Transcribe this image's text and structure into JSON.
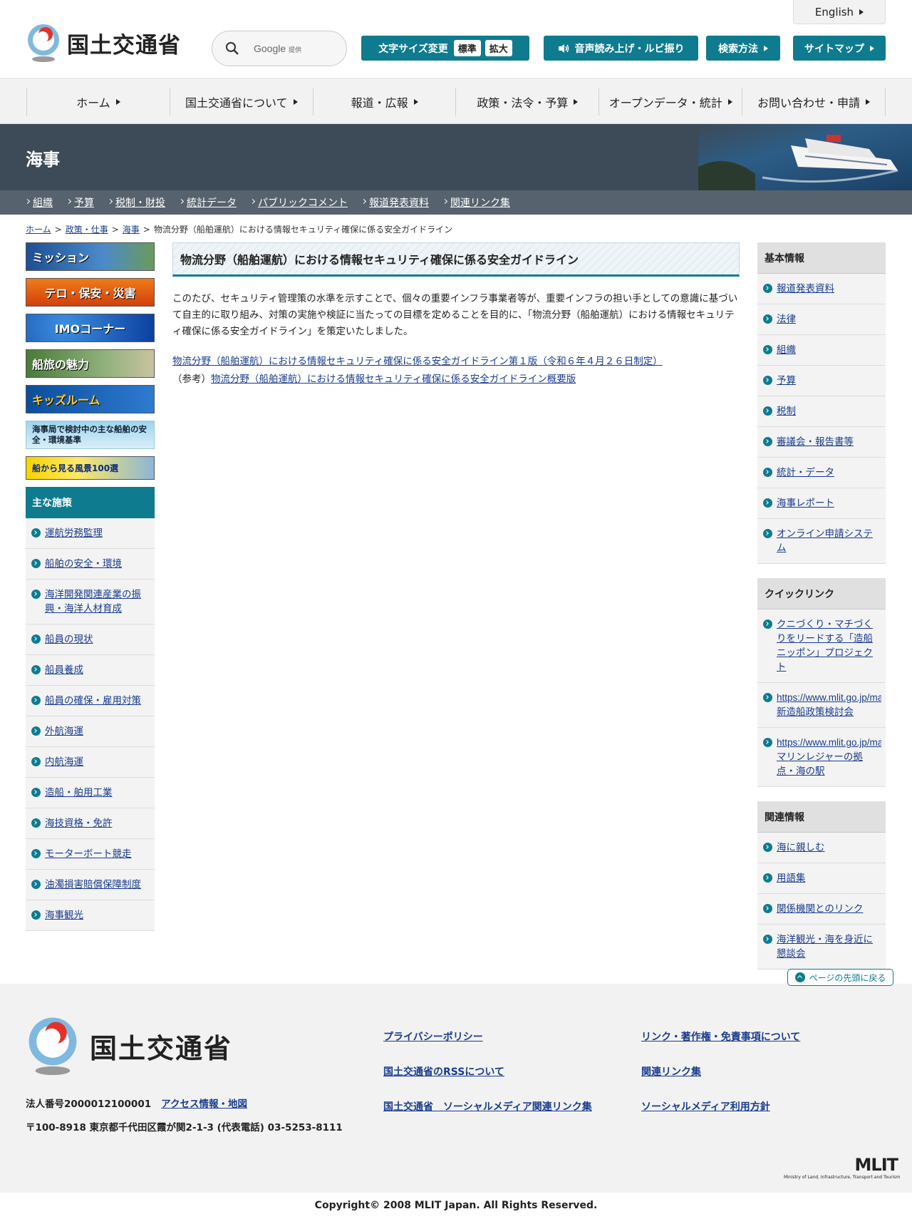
{
  "header": {
    "logo_text": "国土交通省",
    "search_placeholder": "Google",
    "search_provider": "提供",
    "english_label": "English",
    "font_size_label": "文字サイズ変更",
    "font_size_standard": "標準",
    "font_size_large": "拡大",
    "audio_label": "音声読み上げ・ルビ振り",
    "search_method_label": "検索方法",
    "sitemap_label": "サイトマップ"
  },
  "gnav": {
    "items": [
      {
        "label": "ホーム"
      },
      {
        "label": "国土交通省について"
      },
      {
        "label": "報道・広報"
      },
      {
        "label": "政策・法令・予算"
      },
      {
        "label": "オープンデータ・統計"
      },
      {
        "label": "お問い合わせ・申請"
      }
    ]
  },
  "section": {
    "title": "海事",
    "subnav": [
      {
        "label": "組織"
      },
      {
        "label": "予算"
      },
      {
        "label": "税制・財投"
      },
      {
        "label": "統計データ"
      },
      {
        "label": "パブリックコメント"
      },
      {
        "label": "報道発表資料"
      },
      {
        "label": "関連リンク集"
      }
    ]
  },
  "breadcrumb": {
    "home": "ホーム",
    "policy": "政策・仕事",
    "maritime": "海事",
    "current": "物流分野（船舶運航）における情報セキュリティ確保に係る安全ガイドライン",
    "separator": ">"
  },
  "left": {
    "banners": [
      {
        "label": "ミッション"
      },
      {
        "label": "テロ・保安・災害"
      },
      {
        "label": "IMOコーナー"
      },
      {
        "label": "船旅の魅力"
      },
      {
        "label": "キッズルーム"
      },
      {
        "label": "海事局で検討中の主な船舶の安全・環境基準"
      },
      {
        "label": "船から見る風景100選"
      }
    ],
    "policies_head": "主な施策",
    "policies": [
      {
        "label": "運航労務監理"
      },
      {
        "label": "船舶の安全・環境"
      },
      {
        "label": "海洋開発関連産業の振興・海洋人材育成"
      },
      {
        "label": "船員の現状"
      },
      {
        "label": "船員養成"
      },
      {
        "label": "船員の確保・雇用対策"
      },
      {
        "label": "外航海運"
      },
      {
        "label": "内航海運"
      },
      {
        "label": "造船・舶用工業"
      },
      {
        "label": "海技資格・免許"
      },
      {
        "label": "モーターボート競走"
      },
      {
        "label": "油濁損害賠償保障制度"
      },
      {
        "label": "海事観光"
      }
    ]
  },
  "main": {
    "title": "物流分野（船舶運航）における情報セキュリティ確保に係る安全ガイドライン",
    "body": "このたび、セキュリティ管理策の水準を示すことで、個々の重要インフラ事業者等が、重要インフラの担い手としての意識に基づいて自主的に取り組み、対策の実施や検証に当たっての目標を定めることを目的に、「物流分野（船舶運航）における情報セキュリティ確保に係る安全ガイドライン」を策定いたしました。",
    "link1": "物流分野（船舶運航）における情報セキュリティ確保に係る安全ガイドライン第１版（令和６年４月２６日制定）",
    "ref_prefix": "（参考）",
    "link2": "物流分野（船舶運航）における情報セキュリティ確保に係る安全ガイドライン概要版"
  },
  "right": {
    "basic_head": "基本情報",
    "basic": [
      {
        "label": "報道発表資料"
      },
      {
        "label": "法律"
      },
      {
        "label": "組織"
      },
      {
        "label": "予算"
      },
      {
        "label": "税制"
      },
      {
        "label": "審議会・報告書等"
      },
      {
        "label": "統計・データ"
      },
      {
        "label": "海事レポート"
      },
      {
        "label": "オンライン申請システム"
      }
    ],
    "quick_head": "クイックリンク",
    "quick": [
      {
        "label": "クニづくり・マチづくりをリードする「造船ニッポン」プロジェクト"
      },
      {
        "url": "https://www.mlit.go.jp/maritime/",
        "label": "新造船政策検討会"
      },
      {
        "url": "https://www.mlit.go.jp/maritime/",
        "label": "マリンレジャーの拠点・海の駅"
      }
    ],
    "related_head": "関連情報",
    "related": [
      {
        "label": "海に親しむ"
      },
      {
        "label": "用語集"
      },
      {
        "label": "関係機関とのリンク"
      },
      {
        "label": "海洋観光・海を身近に懇談会"
      }
    ]
  },
  "footer": {
    "pagetop": "ページの先頭に戻る",
    "logo_text": "国土交通省",
    "corp_number": "法人番号2000012100001",
    "access": "アクセス情報・地図",
    "address": "〒100-8918 東京都千代田区霞が関2-1-3 (代表電話) 03-5253-8111",
    "links": [
      {
        "label": "プライバシーポリシー"
      },
      {
        "label": "リンク・著作権・免責事項について"
      },
      {
        "label": "国土交通省のRSSについて"
      },
      {
        "label": "関連リンク集"
      },
      {
        "label": "国土交通省　ソーシャルメディア関連リンク集"
      },
      {
        "label": "ソーシャルメディア利用方針"
      }
    ],
    "mlit_mark": "MLIT",
    "mlit_sub": "Ministry of Land, Infrastructure, Transport and Tourism",
    "copyright": "Copyright© 2008 MLIT Japan. All Rights Reserved."
  },
  "colors": {
    "accent": "#0f7b8e",
    "banner_bg": "#3d4a57",
    "link": "#1a3d8f"
  }
}
